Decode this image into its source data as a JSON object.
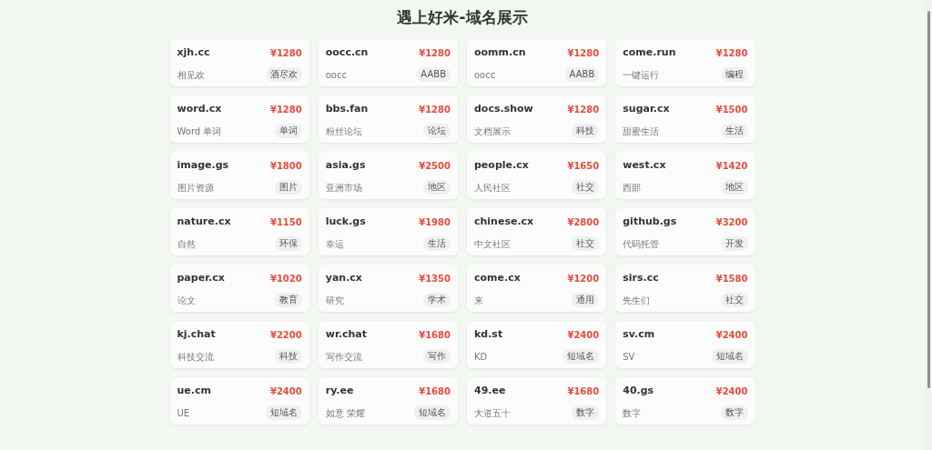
{
  "page": {
    "title": "遇上好米-域名展示"
  },
  "domains": [
    {
      "name": "xjh.cc",
      "price": "¥1280",
      "description": "相见欢",
      "tag": "酒尽欢"
    },
    {
      "name": "oocc.cn",
      "price": "¥1280",
      "description": "oocc",
      "tag": "AABB"
    },
    {
      "name": "oomm.cn",
      "price": "¥1280",
      "description": "oocc",
      "tag": "AABB"
    },
    {
      "name": "come.run",
      "price": "¥1280",
      "description": "一键运行",
      "tag": "编程"
    },
    {
      "name": "word.cx",
      "price": "¥1280",
      "description": "Word 单词",
      "tag": "单词"
    },
    {
      "name": "bbs.fan",
      "price": "¥1280",
      "description": "粉丝论坛",
      "tag": "论坛"
    },
    {
      "name": "docs.show",
      "price": "¥1280",
      "description": "文档展示",
      "tag": "科技"
    },
    {
      "name": "sugar.cx",
      "price": "¥1500",
      "description": "甜蜜生活",
      "tag": "生活"
    },
    {
      "name": "image.gs",
      "price": "¥1800",
      "description": "图片资源",
      "tag": "图片"
    },
    {
      "name": "asia.gs",
      "price": "¥2500",
      "description": "亚洲市场",
      "tag": "地区"
    },
    {
      "name": "people.cx",
      "price": "¥1650",
      "description": "人民社区",
      "tag": "社交"
    },
    {
      "name": "west.cx",
      "price": "¥1420",
      "description": "西部",
      "tag": "地区"
    },
    {
      "name": "nature.cx",
      "price": "¥1150",
      "description": "自然",
      "tag": "环保"
    },
    {
      "name": "luck.gs",
      "price": "¥1980",
      "description": "幸运",
      "tag": "生活"
    },
    {
      "name": "chinese.cx",
      "price": "¥2800",
      "description": "中文社区",
      "tag": "社交"
    },
    {
      "name": "github.gs",
      "price": "¥3200",
      "description": "代码托管",
      "tag": "开发"
    },
    {
      "name": "paper.cx",
      "price": "¥1020",
      "description": "论文",
      "tag": "教育"
    },
    {
      "name": "yan.cx",
      "price": "¥1350",
      "description": "研究",
      "tag": "学术"
    },
    {
      "name": "come.cx",
      "price": "¥1200",
      "description": "来",
      "tag": "通用"
    },
    {
      "name": "sirs.cc",
      "price": "¥1580",
      "description": "先生们",
      "tag": "社交"
    },
    {
      "name": "kj.chat",
      "price": "¥2200",
      "description": "科技交流",
      "tag": "科技"
    },
    {
      "name": "wr.chat",
      "price": "¥1680",
      "description": "写作交流",
      "tag": "写作"
    },
    {
      "name": "kd.st",
      "price": "¥2400",
      "description": "KD",
      "tag": "短域名"
    },
    {
      "name": "sv.cm",
      "price": "¥2400",
      "description": "SV",
      "tag": "短域名"
    },
    {
      "name": "ue.cm",
      "price": "¥2400",
      "description": "UE",
      "tag": "短域名"
    },
    {
      "name": "ry.ee",
      "price": "¥1680",
      "description": "如意 荣耀",
      "tag": "短域名"
    },
    {
      "name": "49.ee",
      "price": "¥1680",
      "description": "大道五十",
      "tag": "数字"
    },
    {
      "name": "40.gs",
      "price": "¥2400",
      "description": "数字",
      "tag": "数字"
    }
  ]
}
